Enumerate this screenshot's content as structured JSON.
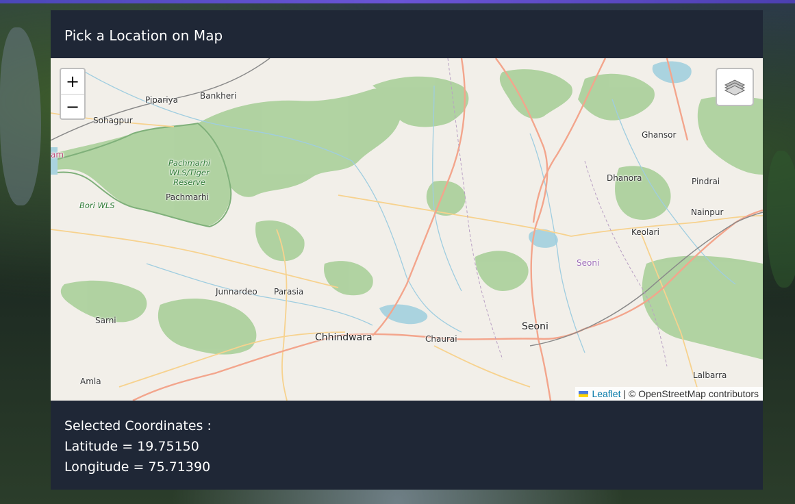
{
  "card": {
    "title": "Pick a Location on Map"
  },
  "map": {
    "zoom_in_label": "+",
    "zoom_out_label": "−",
    "layers_icon": "layers-icon",
    "places": {
      "pipariya": "Pipariya",
      "bankheri": "Bankheri",
      "sohagpur": "Sohagpur",
      "am": "am",
      "pachmarhi_wls_1": "Pachmarhi",
      "pachmarhi_wls_2": "WLS/Tiger",
      "pachmarhi_wls_3": "Reserve",
      "pachmarhi": "Pachmarhi",
      "bori_wls": "Bori WLS",
      "junnardeo": "Junnardeo",
      "parasia": "Parasia",
      "sarni": "Sarni",
      "chhindwara": "Chhindwara",
      "chaurai": "Chaurai",
      "seoni_city": "Seoni",
      "seoni_district": "Seoni",
      "amla": "Amla",
      "ghansor": "Ghansor",
      "dhanora": "Dhanora",
      "pindrai": "Pindrai",
      "nainpur": "Nainpur",
      "keolari": "Keolari",
      "lalbarra": "Lalbarra"
    },
    "attribution": {
      "leaflet": "Leaflet",
      "separator": "|",
      "osm": "© OpenStreetMap contributors"
    }
  },
  "coordinates": {
    "heading": "Selected Coordinates :",
    "latitude_text": "Latitude = 19.75150",
    "longitude_text": "Longitude = 75.71390"
  },
  "colors": {
    "card_bg": "#1f2736",
    "map_land": "#f2efe9",
    "forest": "#add19e",
    "water": "#aad3df",
    "road_major": "#f3a58c",
    "road_minor": "#f7d28e",
    "accent_bar": "#5a4fc9"
  }
}
